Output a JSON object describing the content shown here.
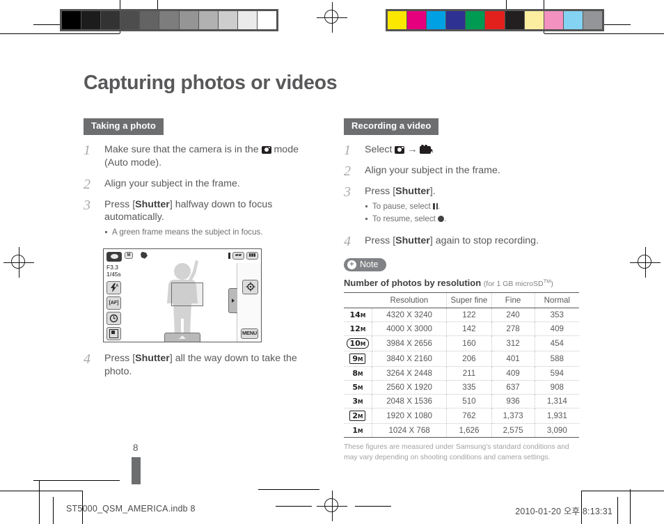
{
  "document": {
    "title": "Capturing photos or videos",
    "page_number": "8"
  },
  "calibration": {
    "gray_swatches": [
      "#000000",
      "#1c1c1c",
      "#333333",
      "#4d4d4d",
      "#636363",
      "#7d7d7d",
      "#959595",
      "#b1b1b1",
      "#cdcdcd",
      "#ebebeb",
      "#ffffff"
    ],
    "color_swatches": [
      "#fbe700",
      "#e5007d",
      "#00a0e4",
      "#2e3191",
      "#009b53",
      "#e3211c",
      "#231f20",
      "#fbeea0",
      "#f391c0",
      "#84d3f2",
      "#939598"
    ],
    "frame_color": "#545454"
  },
  "left_column": {
    "section_title": "Taking a photo",
    "steps": [
      {
        "num": "1",
        "text_before": "Make sure that the camera is in the ",
        "icon": "camera-icon",
        "text_after": " mode (Auto mode)."
      },
      {
        "num": "2",
        "text": "Align your subject in the frame."
      },
      {
        "num": "3",
        "text_before": "Press [",
        "bold": "Shutter",
        "text_after": "] halfway down to focus automatically.",
        "subnotes": [
          "A green frame means the subject in focus."
        ]
      },
      {
        "num": "4",
        "text_before": "Press [",
        "bold": "Shutter",
        "text_after": "] all the way down to take the photo."
      }
    ],
    "camera_screen": {
      "aperture": "F3.3",
      "shutter_speed": "1/45s",
      "mode_icon": "auto-mode-icon",
      "top_icons": [
        "resolution-icon",
        "shake-warning-icon"
      ],
      "battery_icons": [
        "memory-card-icon",
        "battery-icon"
      ],
      "left_icons": [
        "flash-auto-icon",
        "focus-af-icon",
        "timer-off-icon",
        "image-adjust-icon"
      ],
      "right_icons": [
        "settings-icon"
      ],
      "menu_label": "MENU",
      "bottom_tab_icon": "chevron-up-icon",
      "side_tab_icon": "chevron-right-icon"
    }
  },
  "right_column": {
    "section_title": "Recording a video",
    "steps": [
      {
        "num": "1",
        "text_before": "Select ",
        "icon1": "camera-icon",
        "arrow": "→",
        "icon2": "camcorder-icon",
        "text_after": "."
      },
      {
        "num": "2",
        "text": "Align your subject in the frame."
      },
      {
        "num": "3",
        "text_before": "Press [",
        "bold": "Shutter",
        "text_after": "].",
        "subnotes": [
          {
            "text_before": "To pause, select ",
            "icon": "pause-icon",
            "text_after": "."
          },
          {
            "text_before": "To resume, select ",
            "icon": "record-icon",
            "text_after": "."
          }
        ]
      },
      {
        "num": "4",
        "text_before": "Press [",
        "bold": "Shutter",
        "text_after": "] again to stop recording."
      }
    ],
    "note_badge": {
      "icon": "plus-circle-icon",
      "label": "Note"
    },
    "table_caption": {
      "main": "Number of photos by resolution",
      "sub": "(for 1 GB microSD",
      "sup": "TM",
      "sub_end": ")"
    },
    "table": {
      "headers": [
        "",
        "Resolution",
        "Super fine",
        "Fine",
        "Normal"
      ],
      "rows": [
        {
          "icon": "14M",
          "icon_style": "plain",
          "resolution": "4320 X 3240",
          "super_fine": "122",
          "fine": "240",
          "normal": "353"
        },
        {
          "icon": "12M",
          "icon_style": "plain",
          "resolution": "4000 X 3000",
          "super_fine": "142",
          "fine": "278",
          "normal": "409"
        },
        {
          "icon": "10M",
          "icon_style": "rounded",
          "resolution": "3984 X 2656",
          "super_fine": "160",
          "fine": "312",
          "normal": "454"
        },
        {
          "icon": "9M",
          "icon_style": "boxed",
          "resolution": "3840 X 2160",
          "super_fine": "206",
          "fine": "401",
          "normal": "588"
        },
        {
          "icon": "8M",
          "icon_style": "plain",
          "resolution": "3264 X 2448",
          "super_fine": "211",
          "fine": "409",
          "normal": "594"
        },
        {
          "icon": "5M",
          "icon_style": "plain",
          "resolution": "2560 X 1920",
          "super_fine": "335",
          "fine": "637",
          "normal": "908"
        },
        {
          "icon": "3M",
          "icon_style": "plain",
          "resolution": "2048 X 1536",
          "super_fine": "510",
          "fine": "936",
          "normal": "1,314"
        },
        {
          "icon": "2M",
          "icon_style": "boxed",
          "resolution": "1920 X 1080",
          "super_fine": "762",
          "fine": "1,373",
          "normal": "1,931"
        },
        {
          "icon": "1M",
          "icon_style": "plain",
          "resolution": "1024 X 768",
          "super_fine": "1,626",
          "fine": "2,575",
          "normal": "3,090"
        }
      ]
    },
    "table_footnote": "These figures are measured under Samsung's standard conditions and may vary depending on shooting conditions and camera settings."
  },
  "footer": {
    "file_name": "ST5000_QSM_AMERICA.indb   8",
    "timestamp": "2010-01-20   오후 8:13:31"
  }
}
